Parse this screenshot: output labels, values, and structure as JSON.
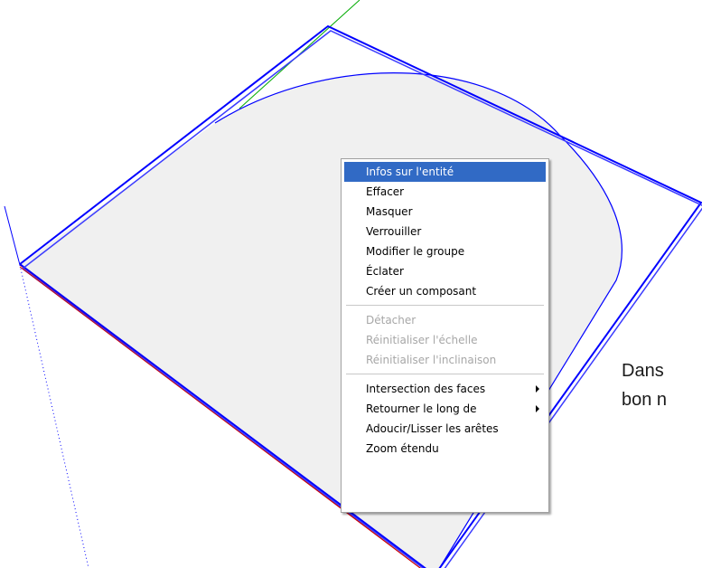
{
  "context_menu": {
    "groups": [
      [
        {
          "label": "Infos sur l'entité",
          "enabled": true,
          "selected": true,
          "submenu": false
        },
        {
          "label": "Effacer",
          "enabled": true,
          "selected": false,
          "submenu": false
        },
        {
          "label": "Masquer",
          "enabled": true,
          "selected": false,
          "submenu": false
        },
        {
          "label": "Verrouiller",
          "enabled": true,
          "selected": false,
          "submenu": false
        },
        {
          "label": "Modifier le groupe",
          "enabled": true,
          "selected": false,
          "submenu": false
        },
        {
          "label": "Éclater",
          "enabled": true,
          "selected": false,
          "submenu": false
        },
        {
          "label": "Créer un composant",
          "enabled": true,
          "selected": false,
          "submenu": false
        }
      ],
      [
        {
          "label": "Détacher",
          "enabled": false,
          "selected": false,
          "submenu": false
        },
        {
          "label": "Réinitialiser l'échelle",
          "enabled": false,
          "selected": false,
          "submenu": false
        },
        {
          "label": "Réinitialiser l'inclinaison",
          "enabled": false,
          "selected": false,
          "submenu": false
        }
      ],
      [
        {
          "label": "Intersection des faces",
          "enabled": true,
          "selected": false,
          "submenu": true
        },
        {
          "label": "Retourner le long de",
          "enabled": true,
          "selected": false,
          "submenu": true
        },
        {
          "label": "Adoucir/Lisser les arêtes",
          "enabled": true,
          "selected": false,
          "submenu": false
        },
        {
          "label": "Zoom étendu",
          "enabled": true,
          "selected": false,
          "submenu": false
        }
      ]
    ]
  },
  "side_text": {
    "line1": "Dans",
    "line2": "bon n"
  },
  "colors": {
    "edge_blue": "#0000ff",
    "face_fill": "#f0f0f0",
    "selection_highlight": "#316ac5",
    "axis_red": "#cc0000",
    "axis_green": "#00aa00"
  }
}
